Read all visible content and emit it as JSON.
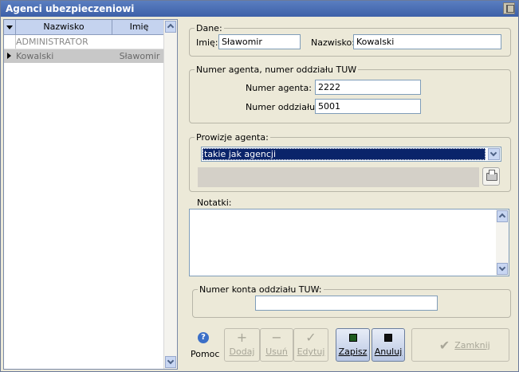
{
  "window": {
    "title": "Agenci ubezpieczeniowi"
  },
  "grid": {
    "columns": [
      "Nazwisko",
      "Imię"
    ],
    "rows": [
      {
        "nazwisko": "ADMINISTRATOR",
        "imie": ""
      },
      {
        "nazwisko": "Kowalski",
        "imie": "Sławomir"
      }
    ]
  },
  "dane": {
    "legend": "Dane:",
    "imie_label": "Imię:",
    "imie_value": "Sławomir",
    "nazwisko_label": "Nazwisko:",
    "nazwisko_value": "Kowalski"
  },
  "numer": {
    "legend": "Numer agenta, numer oddziału TUW",
    "agent_label": "Numer agenta:",
    "agent_value": "2222",
    "oddzial_label": "Numer oddziału:",
    "oddzial_value": "5001"
  },
  "prowizje": {
    "legend": "Prowizje agenta:",
    "selected": "takie jak agencji"
  },
  "notatki": {
    "legend": "Notatki:",
    "value": ""
  },
  "konto": {
    "legend": "Numer konta oddziału TUW:",
    "value": ""
  },
  "toolbar": {
    "help": "Pomoc",
    "add": "Dodaj",
    "delete": "Usuń",
    "edit": "Edytuj",
    "save": "Zapisz",
    "cancel": "Anuluj",
    "close": "Zamknij"
  }
}
